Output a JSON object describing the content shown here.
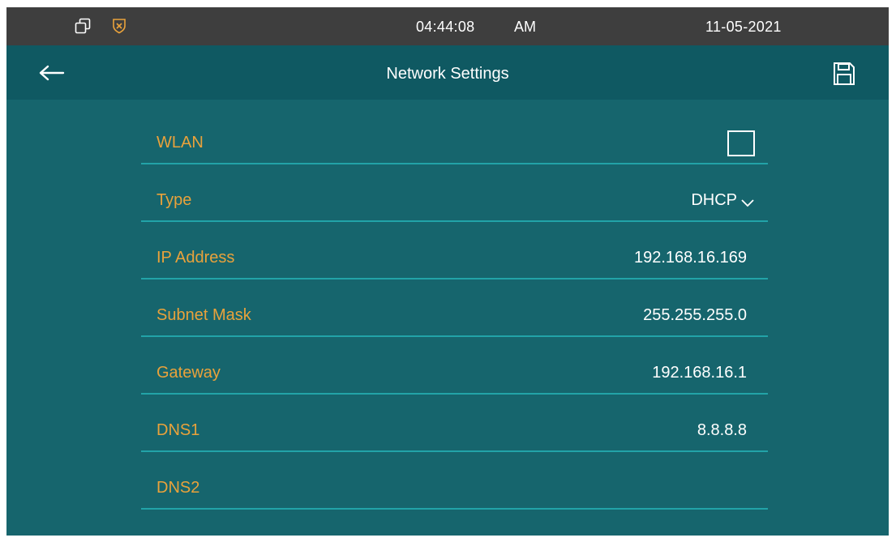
{
  "status_bar": {
    "time": "04:44:08",
    "ampm": "AM",
    "date": "11-05-2021",
    "icons": [
      "windows-icon",
      "shield-icon"
    ]
  },
  "header": {
    "title": "Network Settings",
    "back_icon": "back-arrow-icon",
    "save_icon": "save-icon"
  },
  "settings": {
    "wlan": {
      "label": "WLAN",
      "checked": false
    },
    "type": {
      "label": "Type",
      "value": "DHCP"
    },
    "ip_address": {
      "label": "IP Address",
      "value": "192.168.16.169"
    },
    "subnet_mask": {
      "label": "Subnet Mask",
      "value": "255.255.255.0"
    },
    "gateway": {
      "label": "Gateway",
      "value": "192.168.16.1"
    },
    "dns1": {
      "label": "DNS1",
      "value": "8.8.8.8"
    },
    "dns2": {
      "label": "DNS2",
      "value": ""
    }
  },
  "colors": {
    "background": "#16656d",
    "header": "#0f5962",
    "status_bar": "#3e3e3e",
    "label": "#e9a23b",
    "divider": "#22a3a8"
  }
}
